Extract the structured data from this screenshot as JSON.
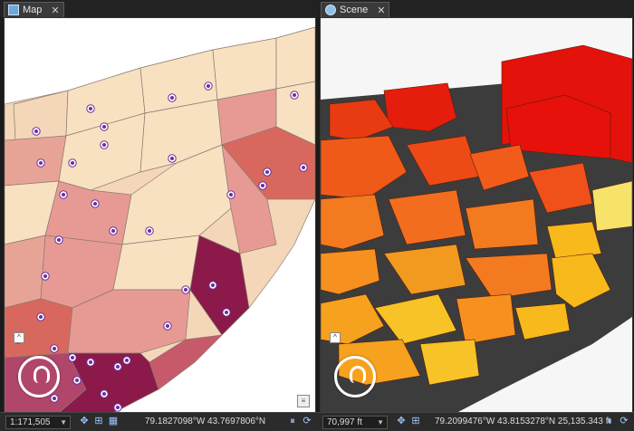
{
  "map_tab": {
    "icon": "map-icon",
    "label": "Map",
    "close": "✕"
  },
  "scene_tab": {
    "icon": "globe-icon",
    "label": "Scene",
    "close": "✕"
  },
  "map_status": {
    "scale": "1:171,505",
    "scale_dropdown": "▼",
    "coordinates": "79.1827098°W 43.7697806°N"
  },
  "scene_status": {
    "scale": "70,997 ft",
    "scale_dropdown": "▼",
    "coordinates": "79.2099476°W 43.8153278°N  25,135.343 ft"
  },
  "colors": {
    "choropleth_light": "#f7e1c1",
    "choropleth_mid": "#e79a93",
    "choropleth_dark": "#8b1a4a",
    "school_marker": "#6b2fa0",
    "scene_low": "#f7e36a",
    "scene_mid": "#f47a1f",
    "scene_high": "#e3120b"
  }
}
